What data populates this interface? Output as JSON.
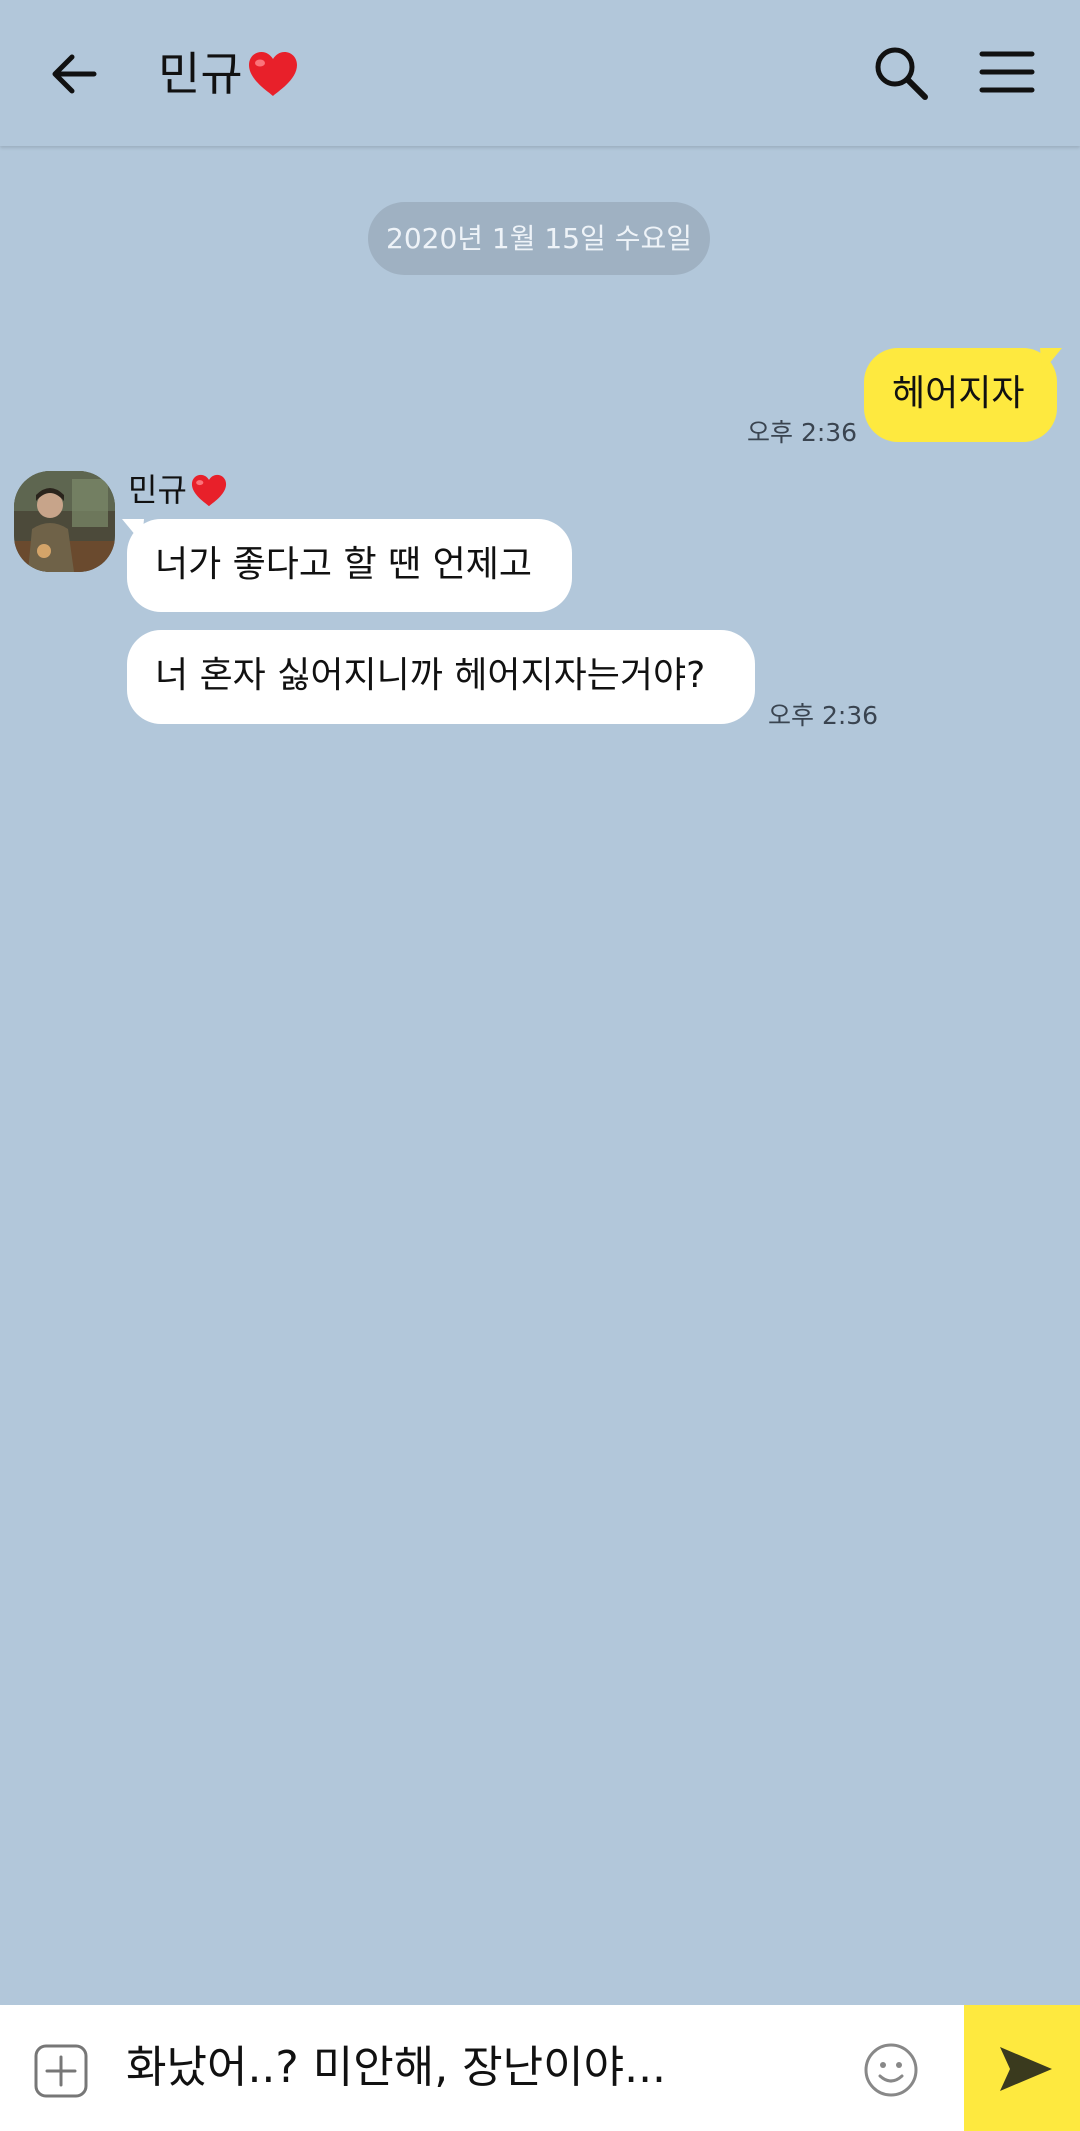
{
  "header": {
    "back_icon": "arrow-left-icon",
    "title": "민규",
    "title_emoji": "red-heart-icon",
    "search_icon": "search-icon",
    "menu_icon": "hamburger-menu-icon"
  },
  "chat": {
    "date": "2020년 1월 15일 수요일",
    "my_message": {
      "text": "헤어지자",
      "time": "오후 2:36"
    },
    "sender": {
      "name": "민규",
      "name_emoji": "red-heart-icon",
      "avatar": "profile-photo"
    },
    "their_messages": [
      {
        "text": "너가 좋다고 할 땐 언제고"
      },
      {
        "text": "너 혼자 싫어지니까 헤어지자는거야?",
        "time": "오후 2:36"
      }
    ]
  },
  "input_bar": {
    "plus_icon": "plus-square-icon",
    "value": "화났어..? 미안해, 장난이야...",
    "emoji_icon": "smiley-icon",
    "send_icon": "send-arrow-icon"
  },
  "colors": {
    "background": "#b2c7da",
    "my_bubble": "#fee93f",
    "their_bubble": "#ffffff",
    "send_button": "#fee93f"
  }
}
